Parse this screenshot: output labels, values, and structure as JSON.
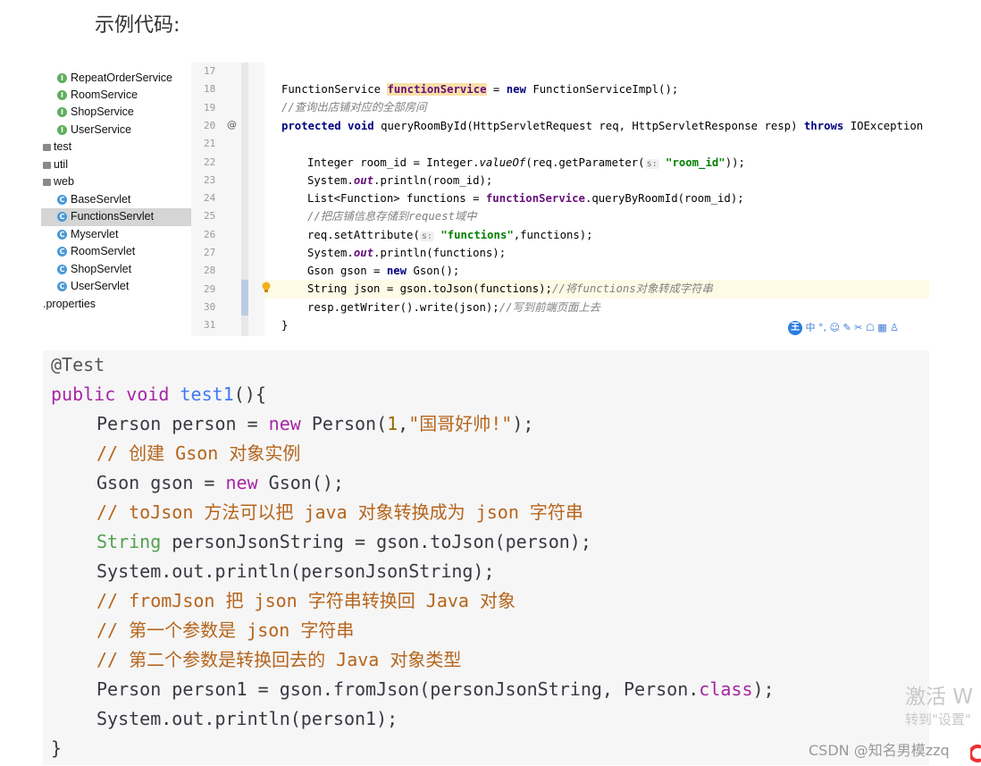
{
  "heading": "示例代码:",
  "tree": {
    "items": [
      {
        "label": "RepeatOrderService",
        "icon": "interface-icon",
        "kind": "iface",
        "badge": "I",
        "selected": false
      },
      {
        "label": "RoomService",
        "icon": "interface-icon",
        "kind": "iface",
        "badge": "I",
        "selected": false
      },
      {
        "label": "ShopService",
        "icon": "interface-icon",
        "kind": "iface",
        "badge": "I",
        "selected": false
      },
      {
        "label": "UserService",
        "icon": "interface-icon",
        "kind": "iface",
        "badge": "I",
        "selected": false
      },
      {
        "label": "test",
        "icon": "folder-icon",
        "kind": "folder",
        "badge": "",
        "selected": false
      },
      {
        "label": "util",
        "icon": "folder-icon",
        "kind": "folder",
        "badge": "",
        "selected": false
      },
      {
        "label": "web",
        "icon": "folder-icon",
        "kind": "folder",
        "badge": "",
        "selected": false
      },
      {
        "label": "BaseServlet",
        "icon": "class-icon",
        "kind": "cls",
        "badge": "C",
        "selected": false
      },
      {
        "label": "FunctionsServlet",
        "icon": "class-icon",
        "kind": "cls",
        "badge": "C",
        "selected": true
      },
      {
        "label": "Myservlet",
        "icon": "class-icon",
        "kind": "cls",
        "badge": "C",
        "selected": false
      },
      {
        "label": "RoomServlet",
        "icon": "class-icon",
        "kind": "cls",
        "badge": "C",
        "selected": false
      },
      {
        "label": "ShopServlet",
        "icon": "class-icon",
        "kind": "cls",
        "badge": "C",
        "selected": false
      },
      {
        "label": "UserServlet",
        "icon": "class-icon",
        "kind": "cls",
        "badge": "C",
        "selected": false
      },
      {
        "label": ".properties",
        "icon": "",
        "kind": "file",
        "badge": "",
        "selected": false
      }
    ]
  },
  "editor": {
    "line_numbers": [
      "17",
      "18",
      "19",
      "20",
      "21",
      "22",
      "23",
      "24",
      "25",
      "26",
      "27",
      "28",
      "29",
      "30",
      "31"
    ],
    "at_marker": "@",
    "hint_s": "s:",
    "l18": {
      "a": "FunctionService ",
      "b": "functionService",
      "c": " = ",
      "d": "new",
      "e": " FunctionServiceImpl();"
    },
    "l19": "//查询出店铺对应的全部房间",
    "l20": {
      "a": "protected",
      "b": " ",
      "c": "void",
      "d": " queryRoomById(HttpServletRequest req, HttpServletResponse resp) ",
      "e": "throws",
      "f": " IOException {"
    },
    "l22": {
      "a": "Integer room_id = Integer.",
      "b": "valueOf",
      "c": "(req.getParameter(",
      "d": "\"room_id\"",
      "e": "));"
    },
    "l23": {
      "a": "System.",
      "b": "out",
      "c": ".println(room_id);"
    },
    "l24": {
      "a": "List<Function> functions = ",
      "b": "functionService",
      "c": ".queryByRoomId(room_id);"
    },
    "l25": "//把店铺信息存储到request域中",
    "l26": {
      "a": "req.setAttribute(",
      "b": "\"functions\"",
      "c": ",functions);"
    },
    "l27": {
      "a": "System.",
      "b": "out",
      "c": ".println(functions);"
    },
    "l28": {
      "a": "Gson gson = ",
      "b": "new",
      "c": " Gson();"
    },
    "l29": {
      "a": "String json = gson.toJson(functions);",
      "b": "//将functions对象转成字符串"
    },
    "l30": {
      "a": "resp.getWriter().write(json);",
      "b": "//写到前端页面上去"
    },
    "l31": "}",
    "toolbar": {
      "logo": "王",
      "items": "中 °, ☺ ✎ ✂ ☖ ▦ ♙"
    }
  },
  "block": {
    "lines": {
      "l1": "@Test",
      "l2": {
        "a": "public",
        "b": " ",
        "c": "void",
        "d": " ",
        "e": "test1",
        "f": "(){"
      },
      "l3": {
        "a": "Person person = ",
        "b": "new",
        "c": " Person(",
        "d": "1",
        "e": ",",
        "f": "\"国哥好帅!\"",
        "g": ");"
      },
      "l4": "// 创建 Gson 对象实例",
      "l5": {
        "a": "Gson gson = ",
        "b": "new",
        "c": " Gson();"
      },
      "l6": "// toJson 方法可以把 java 对象转换成为 json 字符串",
      "l7": {
        "a": "String",
        "b": " personJsonString = gson.toJson(person);"
      },
      "l8": "System.out.println(personJsonString);",
      "l9": "// fromJson 把 json 字符串转换回 Java 对象",
      "l10": "// 第一个参数是 json 字符串",
      "l11": "// 第二个参数是转换回去的 Java 对象类型",
      "l12": {
        "a": "Person person1 = gson.fromJson(personJsonString, Person.",
        "b": "class",
        "c": ");"
      },
      "l13": "System.out.println(person1);",
      "l14": "}"
    }
  },
  "overlay": {
    "activate_line1": "激活 W",
    "activate_line2": "转到\"设置\"",
    "watermark": "CSDN @知名男模zzq"
  },
  "colors": {
    "accent": "#2a7de1",
    "selected_row": "#d5d5d5",
    "highlight_line": "#fdfbe6"
  }
}
